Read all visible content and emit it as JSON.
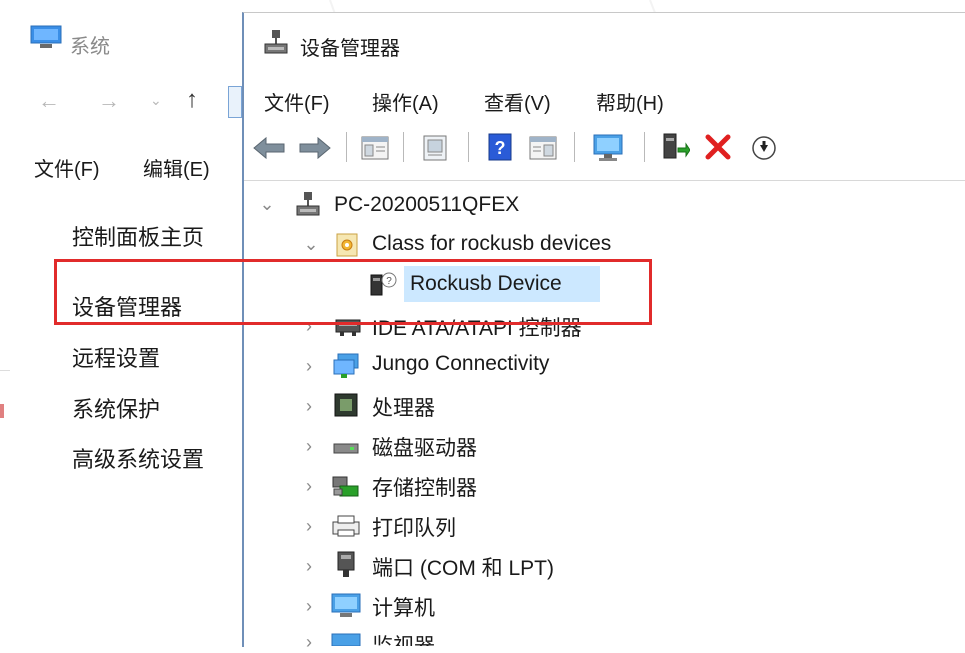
{
  "system_window": {
    "title": "系统",
    "menu": [
      "文件(F)",
      "编辑(E)"
    ],
    "links": [
      "控制面板主页",
      "设备管理器",
      "远程设置",
      "系统保护",
      "高级系统设置"
    ],
    "nav_icons": [
      "back-arrow-icon",
      "forward-arrow-icon",
      "dropdown-icon",
      "up-arrow-icon"
    ]
  },
  "device_manager": {
    "title": "设备管理器",
    "menu": [
      "文件(F)",
      "操作(A)",
      "查看(V)",
      "帮助(H)"
    ],
    "toolbar_icons": [
      "back-icon",
      "forward-icon",
      "properties-pane-icon",
      "print-icon",
      "help-icon",
      "view-pane-icon",
      "monitor-scan-icon",
      "update-driver-icon",
      "uninstall-icon",
      "download-icon"
    ],
    "tree": {
      "root": "PC-20200511QFEX",
      "items": [
        {
          "label": "Class for rockusb devices",
          "expanded": true,
          "icon": "class-device-icon"
        },
        {
          "label": "Rockusb Device",
          "child": true,
          "selected": true,
          "icon": "rockusb-device-icon"
        },
        {
          "label": "IDE ATA/ATAPI 控制器",
          "expanded": false,
          "icon": "ide-controller-icon"
        },
        {
          "label": "Jungo Connectivity",
          "expanded": false,
          "icon": "jungo-icon"
        },
        {
          "label": "处理器",
          "expanded": false,
          "icon": "processor-icon"
        },
        {
          "label": "磁盘驱动器",
          "expanded": false,
          "icon": "disk-drive-icon"
        },
        {
          "label": "存储控制器",
          "expanded": false,
          "icon": "storage-controller-icon"
        },
        {
          "label": "打印队列",
          "expanded": false,
          "icon": "print-queue-icon"
        },
        {
          "label": "端口 (COM 和 LPT)",
          "expanded": false,
          "icon": "port-icon"
        },
        {
          "label": "计算机",
          "expanded": false,
          "icon": "computer-icon"
        },
        {
          "label": "监视器",
          "expanded": false,
          "icon": "monitor-icon"
        }
      ]
    }
  },
  "colors": {
    "highlight_border": "#e12b2b",
    "selection": "#cce8ff",
    "uninstall_x": "#e02020",
    "help_blue": "#2a5bd7"
  }
}
